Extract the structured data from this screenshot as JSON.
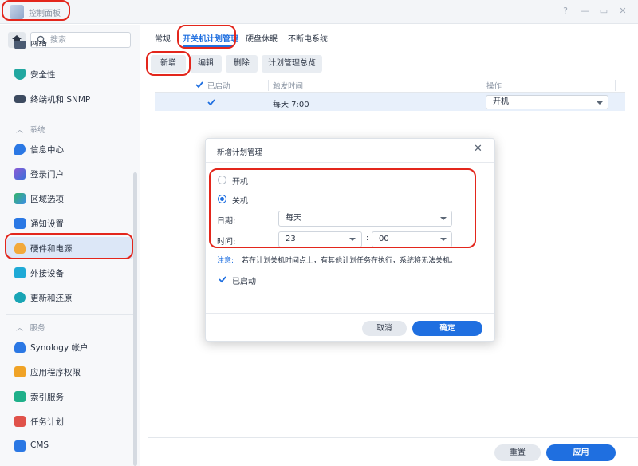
{
  "window": {
    "title": "控制面板",
    "help": "?",
    "minimize": "—",
    "maximize": "▭",
    "close": "✕"
  },
  "sidebar": {
    "search_placeholder": "搜索",
    "top_items": [
      {
        "label": "网络"
      },
      {
        "label": "安全性"
      },
      {
        "label": "终端机和 SNMP"
      }
    ],
    "system_header": "系统",
    "system_items": [
      {
        "label": "信息中心"
      },
      {
        "label": "登录门户"
      },
      {
        "label": "区域选项"
      },
      {
        "label": "通知设置"
      },
      {
        "label": "硬件和电源"
      },
      {
        "label": "外接设备"
      },
      {
        "label": "更新和还原"
      }
    ],
    "services_header": "服务",
    "services_items": [
      {
        "label": "Synology 帐户"
      },
      {
        "label": "应用程序权限"
      },
      {
        "label": "索引服务"
      },
      {
        "label": "任务计划"
      },
      {
        "label": "CMS"
      }
    ]
  },
  "tabs": [
    "常规",
    "开关机计划管理",
    "硬盘休眠",
    "不断电系统"
  ],
  "toolbar": {
    "add": "新增",
    "edit": "编辑",
    "delete": "删除",
    "overview": "计划管理总览"
  },
  "grid": {
    "headers": {
      "enabled": "已启动",
      "trigger": "触发时间",
      "action": "操作"
    },
    "rows": [
      {
        "enabled": true,
        "trigger": "每天 7:00",
        "action": "开机"
      }
    ]
  },
  "dialog": {
    "title": "新增计划管理",
    "options": {
      "power_on": "开机",
      "power_off": "关机",
      "selected": "关机"
    },
    "date_label": "日期:",
    "date_value": "每天",
    "time_label": "时间:",
    "hour": "23",
    "colon": ":",
    "minute": "00",
    "note_title": "注意:",
    "note_text": "若在计划关机时间点上，有其他计划任务在执行，系统将无法关机。",
    "enabled_label": "已启动",
    "enabled": true,
    "cancel": "取消",
    "ok": "确定"
  },
  "footer": {
    "reset": "重置",
    "apply": "应用"
  },
  "colors": {
    "accent": "#1f6fe0",
    "highlight": "#e3261c",
    "selected_row": "#e8f0fb"
  }
}
